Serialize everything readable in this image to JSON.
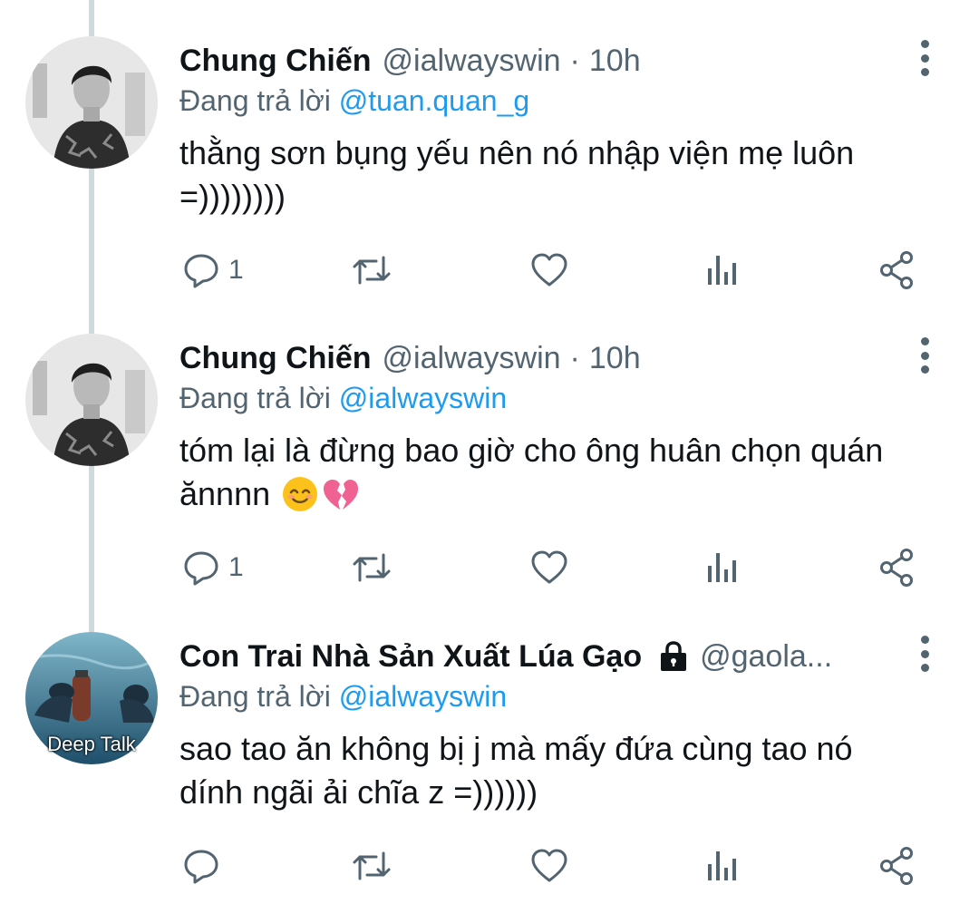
{
  "tweets": [
    {
      "name": "Chung Chiến",
      "handle": "@ialwayswin",
      "separator": "·",
      "time": "10h",
      "replying_prefix": "Đang trả lời",
      "replying_to": "@tuan.quan_g",
      "text_line1": "thằng sơn bụng yếu nên nó nhập viện mẹ luôn",
      "text_line2": "=))))))))",
      "reply_count": "1",
      "retweet_count": "",
      "like_count": "",
      "views_count": ""
    },
    {
      "name": "Chung Chiến",
      "handle": "@ialwayswin",
      "separator": "·",
      "time": "10h",
      "replying_prefix": "Đang trả lời",
      "replying_to": "@ialwayswin",
      "text_line1": "tóm lại là đừng bao giờ cho ông huân chọn quán",
      "text_line2": "ănnnn",
      "reply_count": "1",
      "retweet_count": "",
      "like_count": "",
      "views_count": ""
    },
    {
      "name": "Con Trai Nhà Sản Xuất Lúa Gạo",
      "handle": "@gaola...",
      "replying_prefix": "Đang trả lời",
      "replying_to": "@ialwayswin",
      "text_line1": "sao tao ăn không bị j mà mấy đứa cùng tao nó",
      "text_line2": "dính ngãi ải chĩa z =))))))",
      "avatar_caption": "Deep Talk",
      "reply_count": "",
      "retweet_count": "",
      "like_count": "",
      "views_count": ""
    }
  ],
  "colors": {
    "text": "#0f1419",
    "secondary": "#536471",
    "link": "#1d9bf0",
    "thread_line": "#cfd9de"
  }
}
